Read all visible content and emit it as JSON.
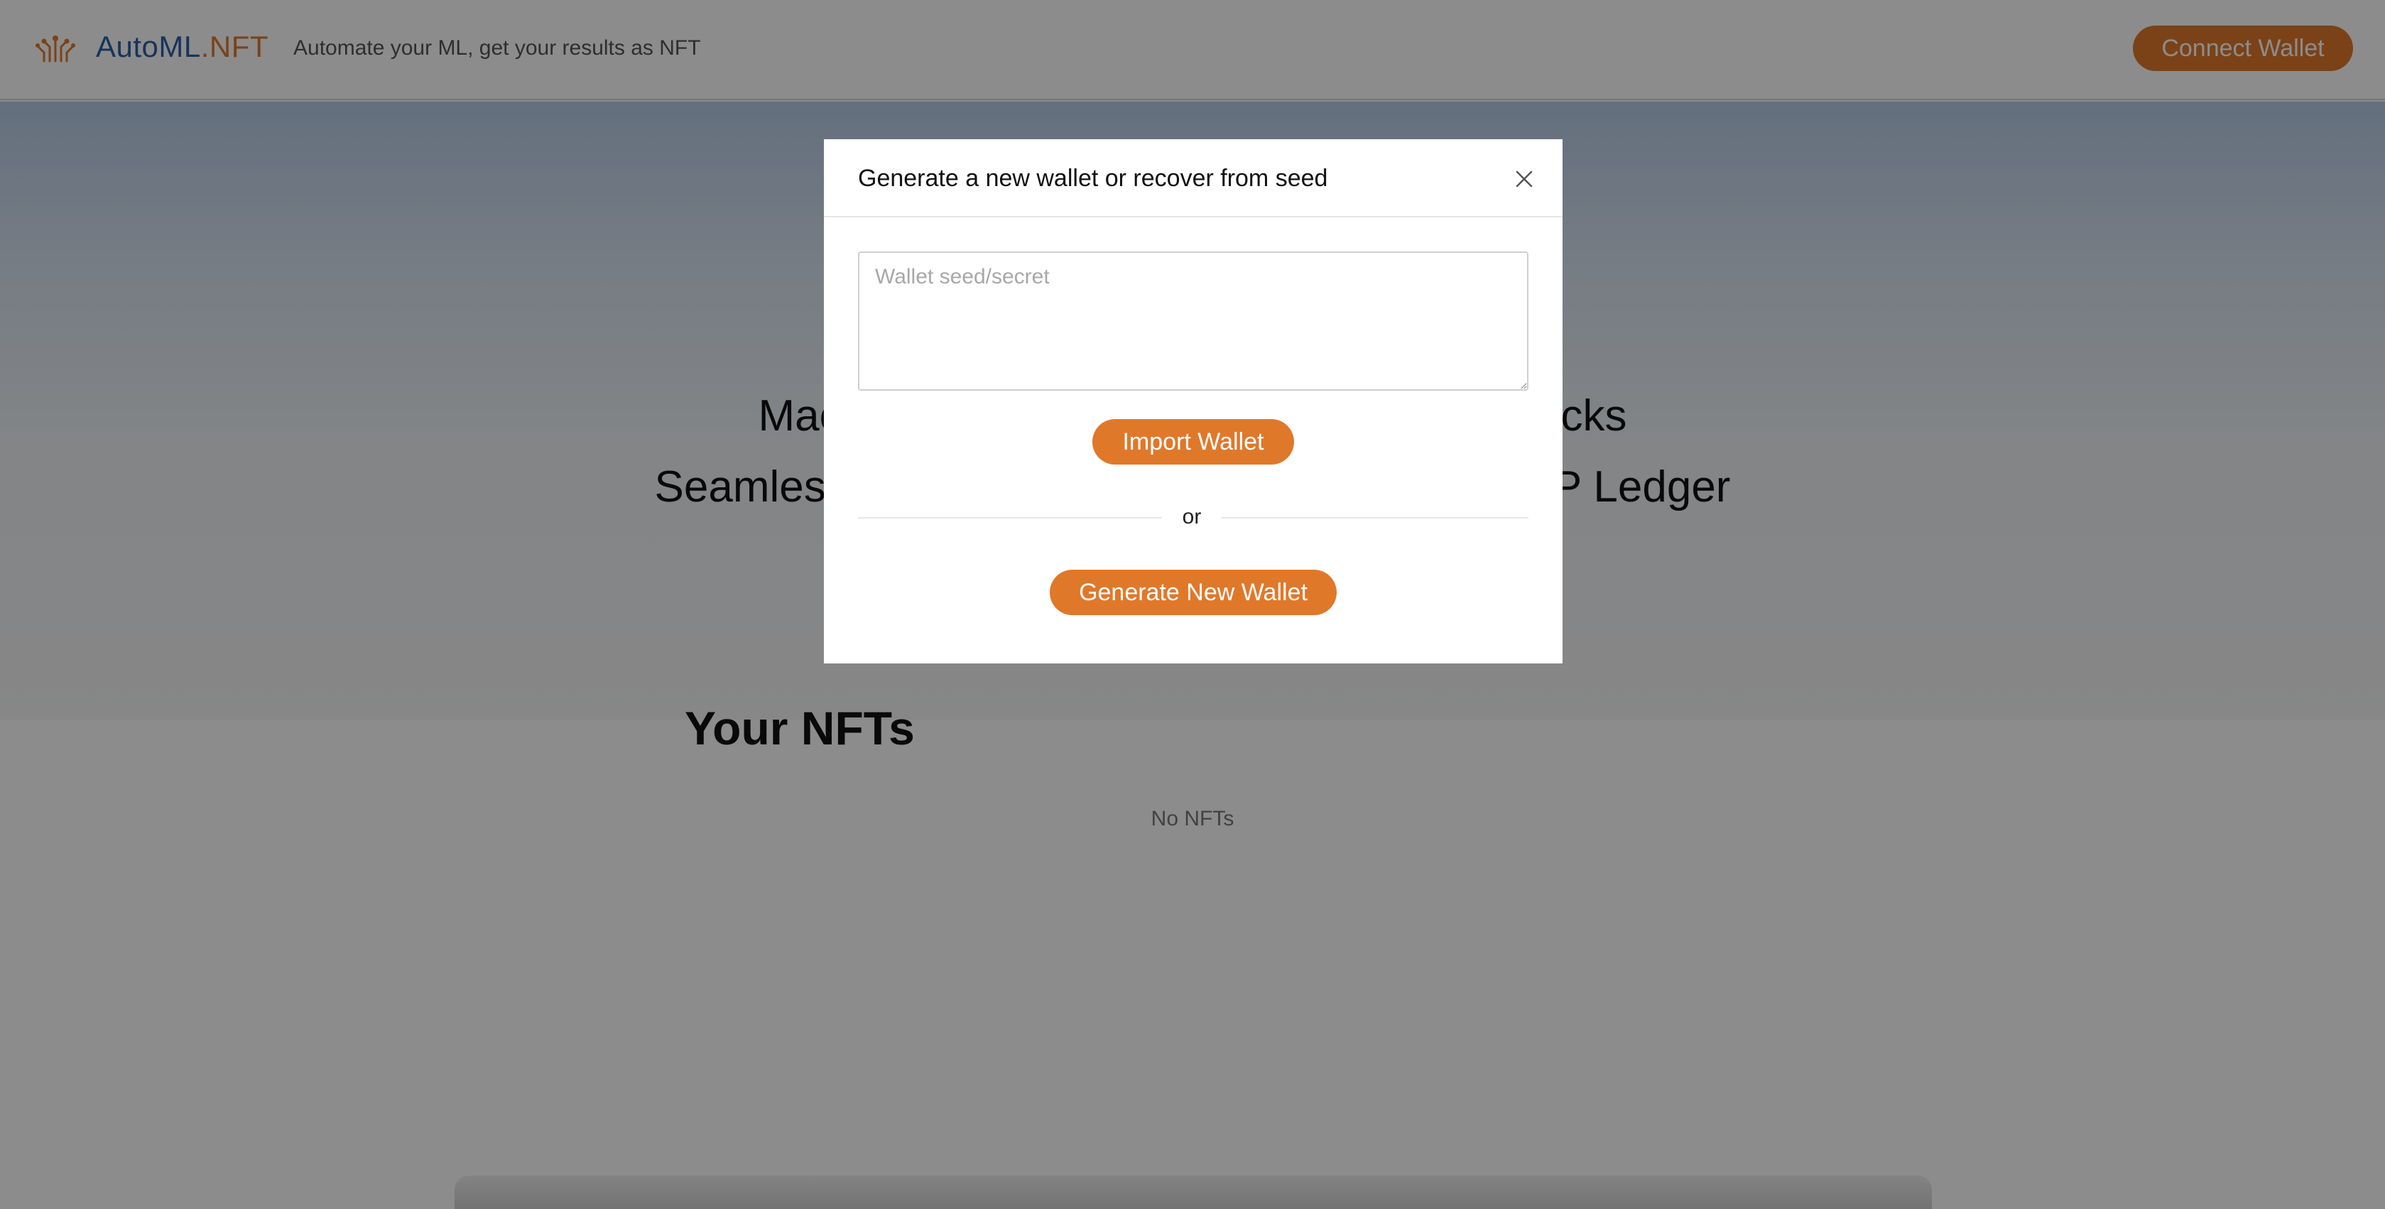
{
  "navbar": {
    "brand_part1": "AutoML",
    "brand_part2": ".NFT",
    "tagline": "Automate your ML, get your results as NFT",
    "connect_button": "Connect Wallet",
    "logo_icon": "circuit-hand-icon"
  },
  "hero": {
    "line1": "Mac                                                          icks",
    "line2": "Seamless                                                       RP Ledger"
  },
  "nfts": {
    "title": "Your NFTs",
    "empty_text": "No NFTs"
  },
  "modal": {
    "title": "Generate a new wallet or recover from seed",
    "close_icon": "close-icon",
    "seed_placeholder": "Wallet seed/secret",
    "seed_value": "",
    "import_button": "Import Wallet",
    "divider_text": "or",
    "generate_button": "Generate New Wallet"
  },
  "colors": {
    "brand_blue": "#2b5fa8",
    "accent_orange": "#e0782a",
    "backdrop": "rgba(0,0,0,0.45)"
  }
}
